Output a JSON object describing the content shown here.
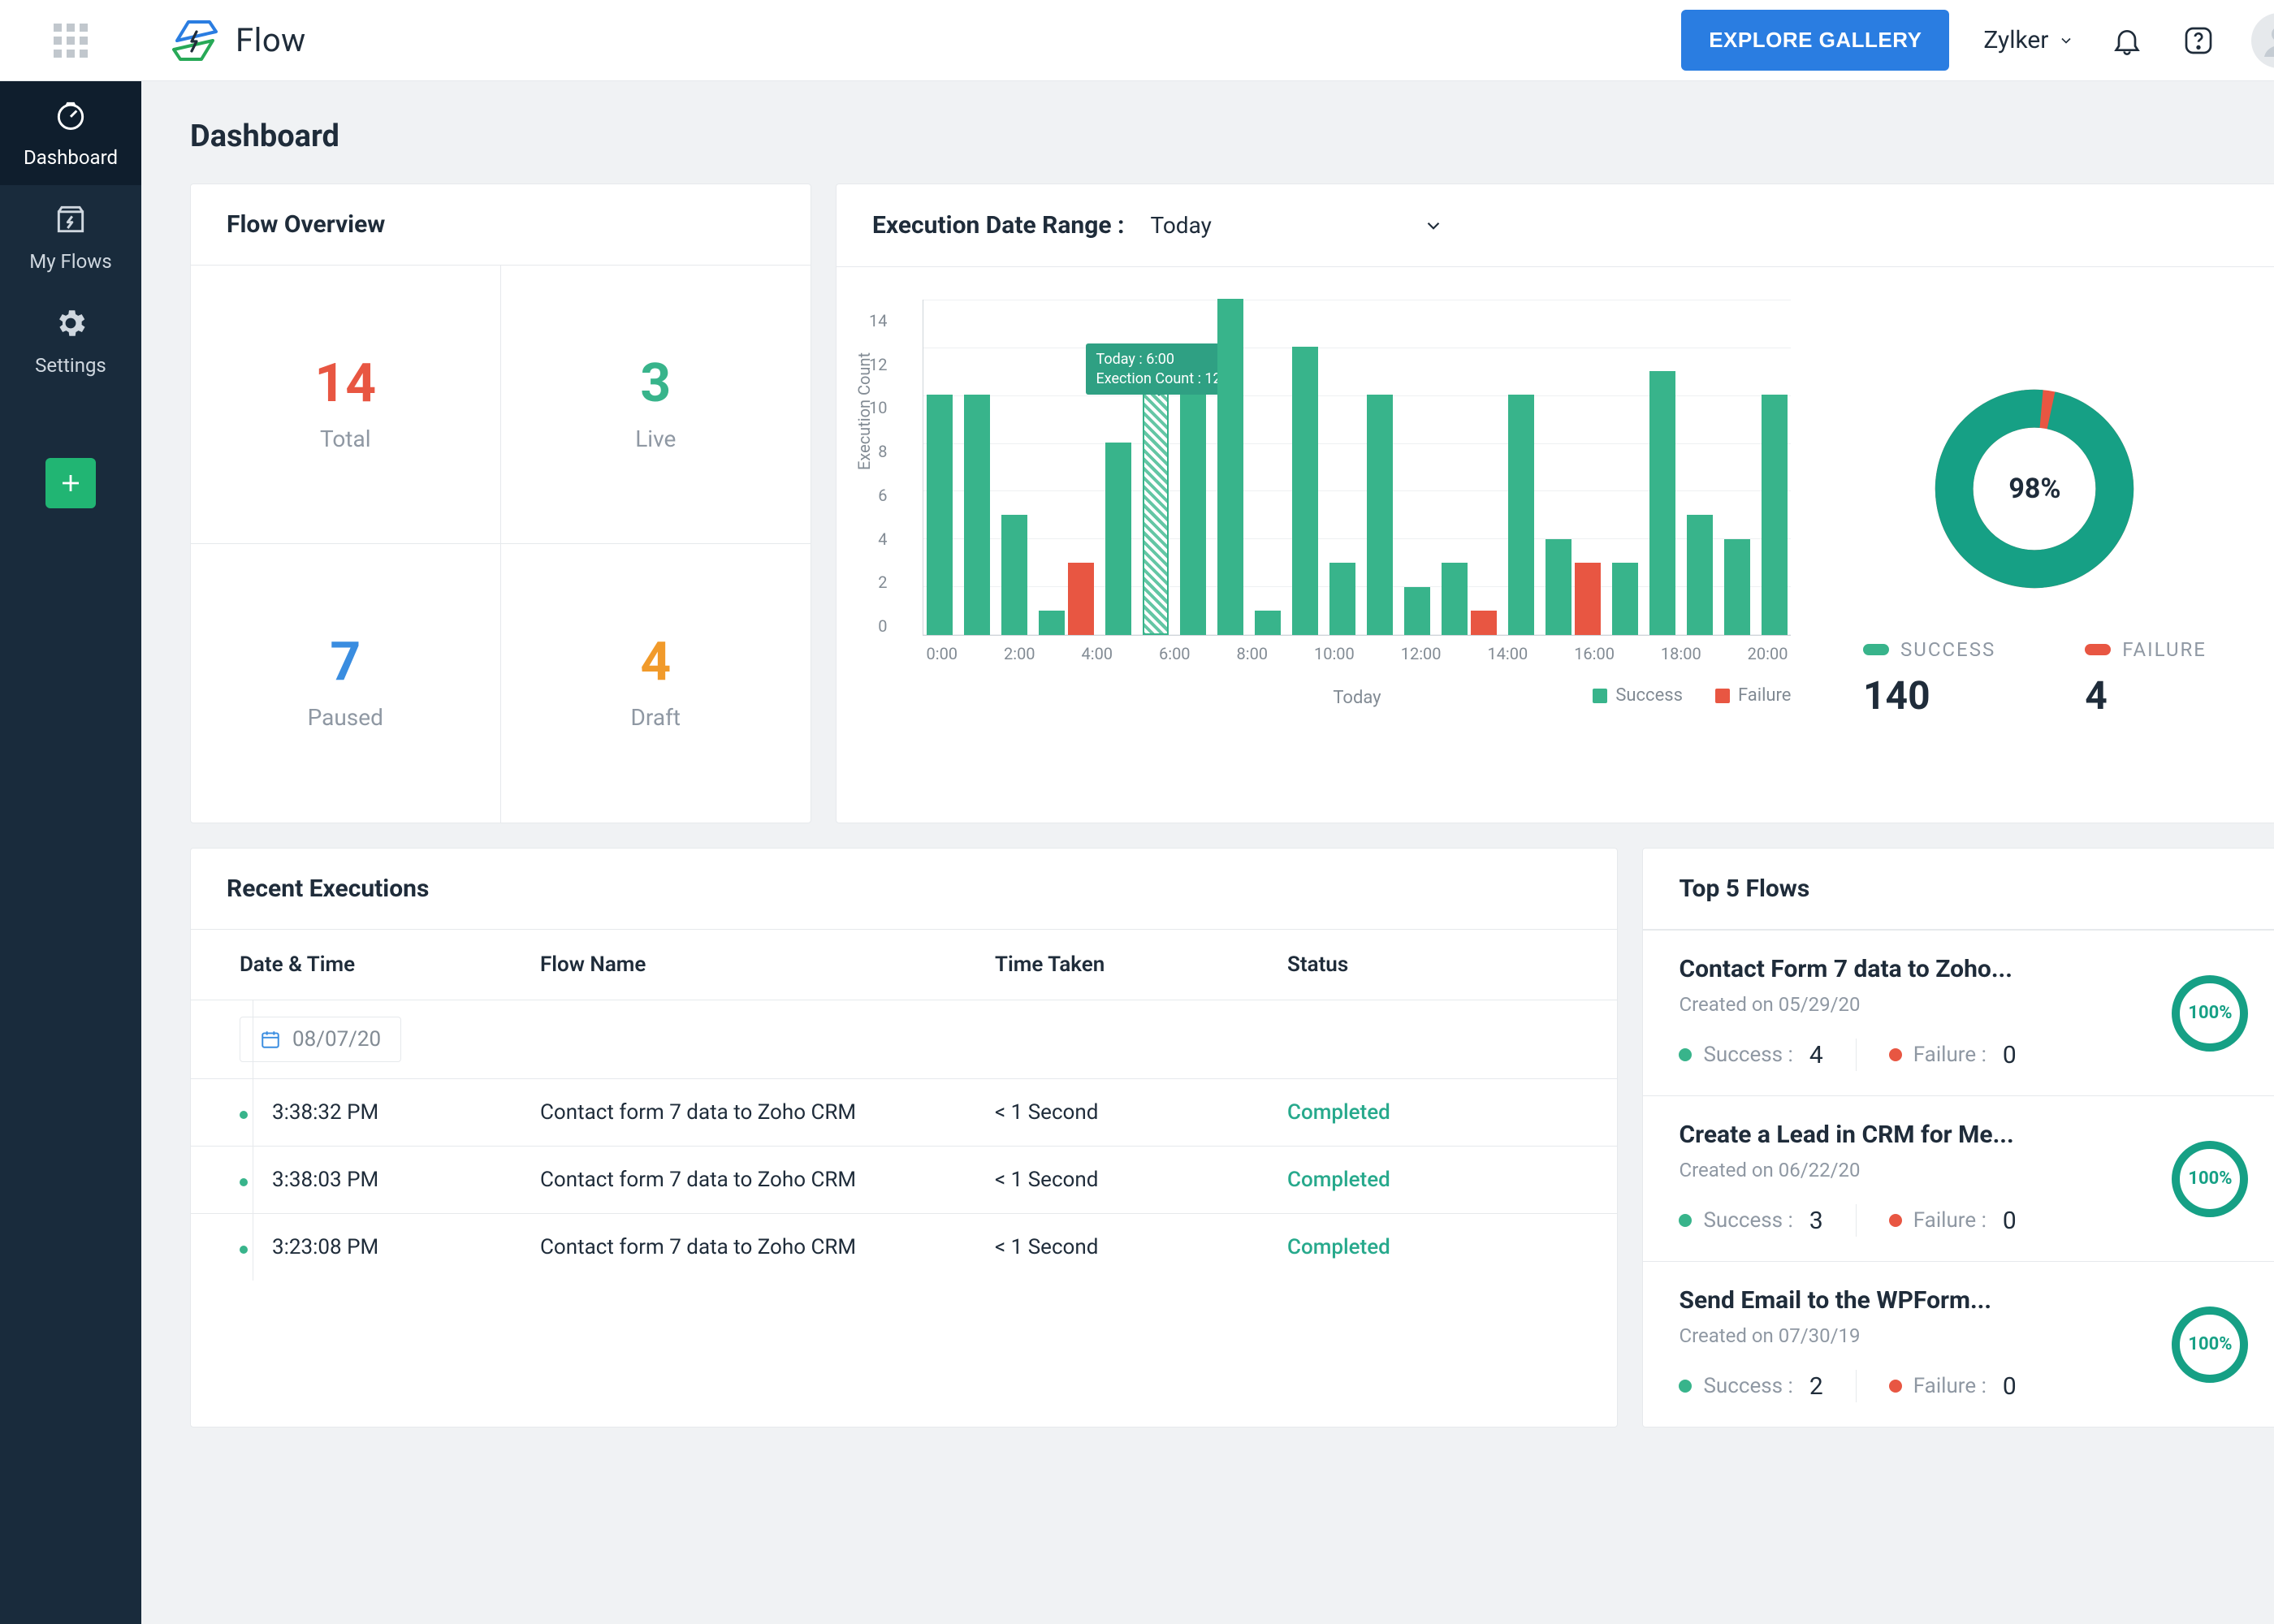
{
  "header": {
    "product_name": "Flow",
    "explore_label": "EXPLORE GALLERY",
    "org_name": "Zylker"
  },
  "sidebar": {
    "items": [
      {
        "label": "Dashboard",
        "active": true
      },
      {
        "label": "My Flows",
        "active": false
      },
      {
        "label": "Settings",
        "active": false
      }
    ]
  },
  "page_title": "Dashboard",
  "overview": {
    "title": "Flow Overview",
    "cells": [
      {
        "value": "14",
        "label": "Total",
        "color": "c-red"
      },
      {
        "value": "3",
        "label": "Live",
        "color": "c-green"
      },
      {
        "value": "7",
        "label": "Paused",
        "color": "c-blue"
      },
      {
        "value": "4",
        "label": "Draft",
        "color": "c-orange"
      }
    ]
  },
  "execution": {
    "title_prefix": "Execution Date Range :",
    "range_selected": "Today",
    "donut_percent": "98%",
    "success_label": "SUCCESS",
    "failure_label": "FAILURE",
    "success_count": "140",
    "failure_count": "4",
    "tooltip_line1": "Today : 6:00",
    "tooltip_line2": "Exection Count : 12",
    "legend_success": "Success",
    "legend_failure": "Failure",
    "xlabel": "Today",
    "ylabel": "Execution Count",
    "ymax": 14
  },
  "chart_data": {
    "type": "bar",
    "ylabel": "Execution Count",
    "xlabel": "Today",
    "ylim": [
      0,
      14
    ],
    "categories": [
      "0:00",
      "2:00",
      "4:00",
      "6:00",
      "8:00",
      "10:00",
      "12:00",
      "14:00",
      "16:00",
      "18:00",
      "20:00"
    ],
    "series": [
      {
        "name": "Success",
        "color": "#38b48b",
        "values": [
          10,
          10,
          5,
          1,
          8,
          12,
          10,
          14,
          1,
          12,
          3,
          10,
          2,
          3,
          10,
          4,
          3,
          11,
          5,
          4,
          10
        ]
      },
      {
        "name": "Failure",
        "color": "#e85642",
        "values": [
          0,
          0,
          0,
          3,
          0,
          0,
          0,
          0,
          0,
          0,
          0,
          0,
          0,
          1,
          0,
          3,
          0,
          0,
          0,
          0,
          0
        ]
      }
    ],
    "highlight_index": 5,
    "tooltip": {
      "index": 5,
      "lines": [
        "Today : 6:00",
        "Exection Count : 12"
      ]
    }
  },
  "recent": {
    "title": "Recent Executions",
    "columns": {
      "date": "Date & Time",
      "name": "Flow Name",
      "time": "Time Taken",
      "status": "Status"
    },
    "date_header": "08/07/20",
    "rows": [
      {
        "time": "3:38:32 PM",
        "name": "Contact form 7 data to Zoho CRM",
        "taken": "< 1 Second",
        "status": "Completed"
      },
      {
        "time": "3:38:03 PM",
        "name": "Contact form 7 data to Zoho CRM",
        "taken": "< 1 Second",
        "status": "Completed"
      },
      {
        "time": "3:23:08 PM",
        "name": "Contact form 7 data to Zoho CRM",
        "taken": "< 1 Second",
        "status": "Completed"
      }
    ]
  },
  "top_flows": {
    "title": "Top 5 Flows",
    "success_label": "Success :",
    "failure_label": "Failure :",
    "created_prefix": "Created on",
    "items": [
      {
        "name": "Contact Form 7 data to Zoho...",
        "created": "05/29/20",
        "success": "4",
        "failure": "0",
        "pct": "100%"
      },
      {
        "name": "Create a Lead in CRM for Me...",
        "created": "06/22/20",
        "success": "3",
        "failure": "0",
        "pct": "100%"
      },
      {
        "name": "Send Email to the WPForm...",
        "created": "07/30/19",
        "success": "2",
        "failure": "0",
        "pct": "100%"
      }
    ]
  }
}
